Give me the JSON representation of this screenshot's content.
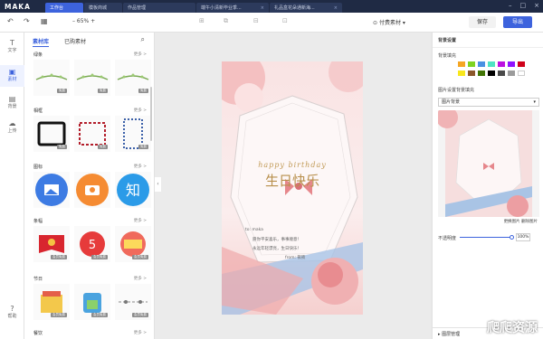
{
  "app": {
    "logo": "MAKA"
  },
  "tabs": [
    {
      "label": "工作台",
      "active": true
    },
    {
      "label": "模板商城",
      "active": false
    },
    {
      "label": "作品管理",
      "active": false
    },
    {
      "label": "端午小清新毕业季...",
      "active": false
    },
    {
      "label": "礼品盒花朵通新海...",
      "active": false
    }
  ],
  "toolbar": {
    "zoom": "65%",
    "pay_label": "付费素材",
    "save": "保存",
    "export": "导出"
  },
  "nav": [
    {
      "label": "文字",
      "icon": "text-icon"
    },
    {
      "label": "素材",
      "icon": "material-icon",
      "active": true
    },
    {
      "label": "背景",
      "icon": "background-icon"
    },
    {
      "label": "上传",
      "icon": "upload-icon"
    }
  ],
  "nav_bottom": "帮助",
  "panel": {
    "tab_library": "素材库",
    "tab_purchased": "已购素材",
    "sections": [
      {
        "title": "绿条",
        "more": "更多 >",
        "badges": [
          "免费",
          "免费",
          "免费"
        ]
      },
      {
        "title": "相框",
        "more": "更多 >",
        "badges": [
          "免费",
          "免费",
          "免费"
        ]
      },
      {
        "title": "图标",
        "more": "更多 >",
        "badges": [
          "",
          "",
          ""
        ]
      },
      {
        "title": "条幅",
        "more": "更多 >",
        "badges": [
          "会员免费",
          "会员免费",
          "会员免费"
        ]
      },
      {
        "title": "节日",
        "more": "更多 >",
        "badges": [
          "会员免费",
          "会员免费",
          "会员免费"
        ]
      },
      {
        "title": "餐饮",
        "more": "更多 >"
      }
    ]
  },
  "card": {
    "script_title": "happy birthday",
    "title": "生日快乐",
    "to": "to: maka",
    "line1": "愿你平安喜乐，事事顺意！",
    "line2": "永远年轻漂亮，生日快乐！",
    "from": "from: 筱筱"
  },
  "right": {
    "header": "背景设置",
    "fill_label": "背景填充",
    "image_label": "图片设置背景填充",
    "select": "图片背景",
    "replace": "更换图片",
    "delete": "删除图片",
    "opacity_label": "不透明度",
    "opacity_value": "100%",
    "layer": "图层管理",
    "swatches": [
      "#f5a623",
      "#7ed321",
      "#4a90e2",
      "#50e3c2",
      "#bd10e0",
      "#9013fe",
      "#d0021b",
      "#f8e71c",
      "#8b572a",
      "#417505",
      "#000000",
      "#4a4a4a",
      "#9b9b9b",
      "#ffffff"
    ]
  },
  "watermark": "爬爬资源"
}
